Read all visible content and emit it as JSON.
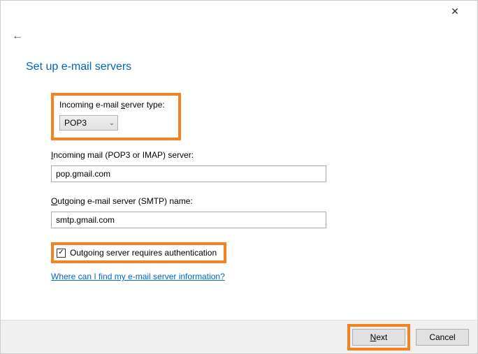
{
  "window": {
    "close_glyph": "✕"
  },
  "nav": {
    "back_glyph": "←"
  },
  "title": "Set up e-mail servers",
  "incoming_type": {
    "label_prefix": "Incoming e-mail ",
    "label_underlined": "s",
    "label_suffix": "erver type:",
    "value": "POP3",
    "chevron": "⌄"
  },
  "incoming_server": {
    "label_underlined": "I",
    "label_suffix": "ncoming mail (POP3 or IMAP) server:",
    "value": "pop.gmail.com"
  },
  "outgoing_server": {
    "label_underlined": "O",
    "label_suffix": "utgoing e-mail server (SMTP) name:",
    "value": "smtp.gmail.com"
  },
  "auth_checkbox": {
    "checked_glyph": "✓",
    "label": "Outgoing server requires authentication"
  },
  "help_link": "Where can I find my e-mail server information?",
  "buttons": {
    "next_underlined": "N",
    "next_suffix": "ext",
    "cancel": "Cancel"
  }
}
